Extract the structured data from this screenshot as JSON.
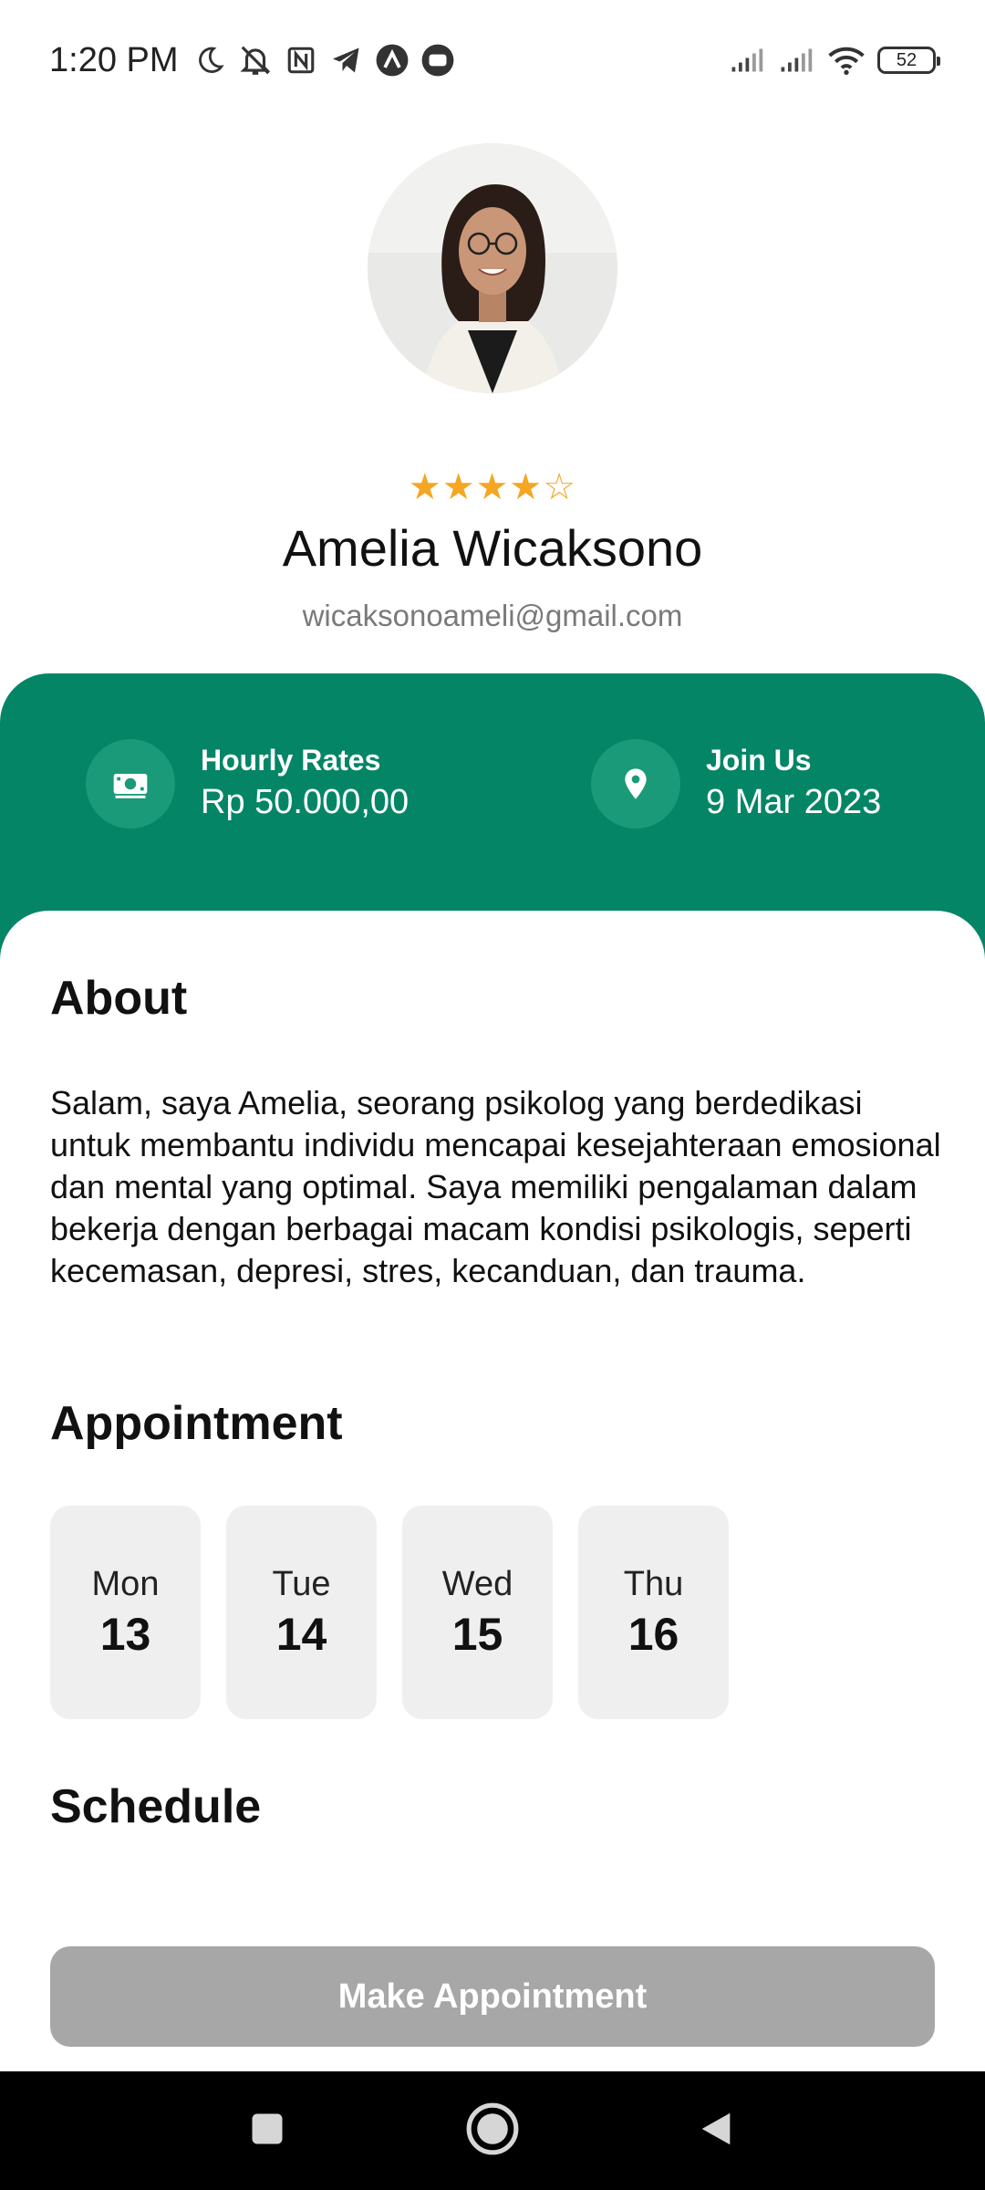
{
  "status_bar": {
    "time": "1:20 PM",
    "battery": "52"
  },
  "profile": {
    "rating": 4,
    "rating_max": 5,
    "name": "Amelia Wicaksono",
    "email": "wicaksonoameli@gmail.com"
  },
  "info": {
    "hourly_label": "Hourly Rates",
    "hourly_value": "Rp 50.000,00",
    "join_label": "Join Us",
    "join_value": "9 Mar 2023"
  },
  "about": {
    "title": "About",
    "text": "Salam, saya Amelia, seorang psikolog yang berdedikasi untuk membantu individu mencapai kesejahteraan emosional dan mental yang optimal. Saya memiliki pengalaman dalam bekerja dengan berbagai macam kondisi psikologis, seperti kecemasan, depresi, stres, kecanduan, dan trauma."
  },
  "appointment": {
    "title": "Appointment",
    "days": [
      {
        "day": "Mon",
        "date": "13"
      },
      {
        "day": "Tue",
        "date": "14"
      },
      {
        "day": "Wed",
        "date": "15"
      },
      {
        "day": "Thu",
        "date": "16"
      }
    ]
  },
  "schedule": {
    "title": "Schedule"
  },
  "action": {
    "button_label": "Make Appointment"
  },
  "colors": {
    "primary_green": "#048566",
    "star": "#F5A623",
    "button_disabled": "#a7a7a7",
    "day_card_bg": "#efefef"
  },
  "icons": {
    "hourly": "money-icon",
    "join": "location-pin-icon"
  }
}
